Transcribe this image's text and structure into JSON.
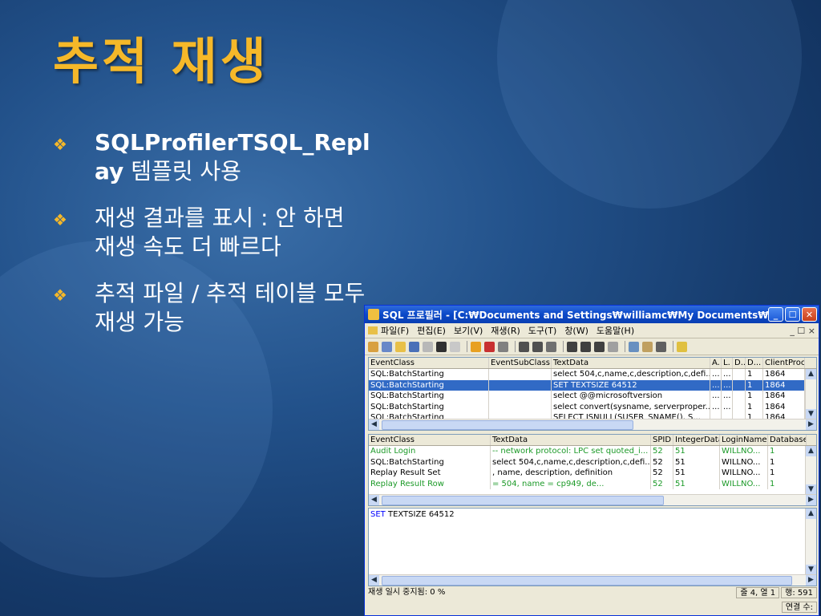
{
  "slide": {
    "title": "추적 재생",
    "bullets": [
      {
        "bold": "SQLProfilerTSQL_Replay",
        "text": " 템플릿 사용"
      },
      {
        "bold": "",
        "text": "재생 결과를 표시 : 안 하면 재생 속도 더 빠르다"
      },
      {
        "bold": "",
        "text": "추적 파일 / 추적 테이블 모두 재생 가능"
      }
    ],
    "bullet_icon": "diamond-bullet-icon"
  },
  "window": {
    "title": "SQL 프로필러 - [C:₩Documents and Settings₩williamc₩My Documents₩PPTs...",
    "menu": [
      "파일(F)",
      "편집(E)",
      "보기(V)",
      "재생(R)",
      "도구(T)",
      "창(W)",
      "도움말(H)"
    ],
    "menu_right": "_ ☐ ×",
    "top_grid": {
      "headers": [
        "EventClass",
        "EventSubClass",
        "TextData",
        "A.",
        "L.",
        "D..",
        "D...",
        "ClientProc"
      ],
      "rows": [
        [
          "SQL:BatchStarting",
          "",
          "select 504,c,name,c,description,c,defi...",
          "...",
          "...",
          "",
          "1",
          "1864"
        ],
        [
          "SQL:BatchStarting",
          "",
          "SET TEXTSIZE 64512",
          "...",
          "...",
          "",
          "1",
          "1864"
        ],
        [
          "SQL:BatchStarting",
          "",
          "select @@microsoftversion",
          "...",
          "...",
          "",
          "1",
          "1864"
        ],
        [
          "SQL:BatchStarting",
          "",
          "select convert(sysname, serverproper...",
          "...",
          "...",
          "",
          "1",
          "1864"
        ],
        [
          "SQL:BatchStarting",
          "",
          "SELECT ISNULL(SUSER_SNAME(), S...",
          "",
          "",
          "",
          "1",
          "1864"
        ]
      ],
      "selected_row": 1
    },
    "bottom_grid": {
      "headers": [
        "EventClass",
        "TextData",
        "SPID",
        "IntegerData",
        "LoginName",
        "DatabaseI"
      ],
      "rows": [
        [
          "Audit Login",
          "-- network protocol: LPC set quoted_i...",
          "52",
          "51",
          "WILLNO...",
          "1"
        ],
        [
          "SQL:BatchStarting",
          "select 504,c,name,c,description,c,defi...",
          "52",
          "51",
          "WILLNO...",
          "1"
        ],
        [
          "Replay Result Set",
          ",  name,  description,  definition",
          "52",
          "51",
          "WILLNO...",
          "1"
        ],
        [
          "Replay Result Row",
          "          = 504,   name        = cp949,   de...",
          "52",
          "51",
          "WILLNO...",
          "1"
        ]
      ],
      "green_rows": [
        0,
        3
      ]
    },
    "text_pane": {
      "keyword": "SET",
      "rest": " TEXTSIZE 64512"
    },
    "status": {
      "left": "재생 일시 중지됨:  0 %",
      "position": "줄 4, 열 1",
      "rows": "행: 591",
      "connections": "연결 수:"
    }
  }
}
